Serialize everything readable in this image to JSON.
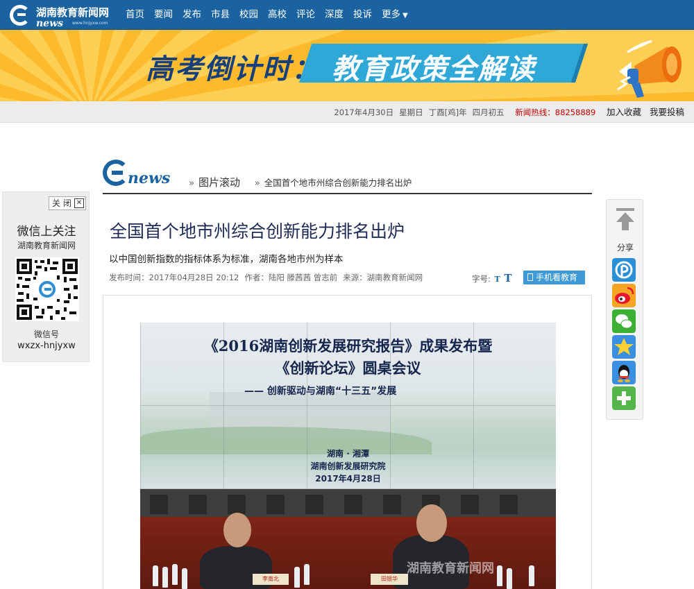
{
  "site": {
    "name": "湖南教育新闻网",
    "logo_word": "news",
    "url": "www.hnjyxw.com"
  },
  "nav": {
    "items": [
      "首页",
      "要闻",
      "发布",
      "市县",
      "校园",
      "高校",
      "评论",
      "深度",
      "投诉",
      "更多"
    ],
    "more_caret": "▼"
  },
  "banner": {
    "left_text": "高考倒计时：",
    "right_text": "教育政策全解读"
  },
  "infobar": {
    "date": "2017年4月30日",
    "weekday": "星期日",
    "lunar_year": "丁酉[鸡]年",
    "lunar_day": "四月初五",
    "hotline_label": "新闻热线：",
    "hotline": "88258889",
    "bookmark": "加入收藏",
    "submit": "我要投稿"
  },
  "breadcrumb": {
    "logo_word": "news",
    "sep": "»",
    "section": "图片滚动",
    "current": "全国首个地市州综合创新能力排名出炉"
  },
  "wechat": {
    "close": "关 闭",
    "close_x": "✕",
    "follow": "微信上关注",
    "site": "湖南教育新闻网",
    "id_label": "微信号",
    "id": "wxzx-hnjyxw"
  },
  "article": {
    "title": "全国首个地市州综合创新能力排名出炉",
    "subtitle": "以中国创新指数的指标体系为标准，湖南各地市州为样本",
    "meta": {
      "published": "发布时间：2017年04月28日  20:12",
      "author": "作者：陆阳 滕茜茜 曾志前",
      "source": "来源：湖南教育新闻网"
    },
    "font_label": "字号:",
    "font_small": "T",
    "font_large": "T",
    "mobile": "手机看教育"
  },
  "photo": {
    "line1": "《2016湖南创新发展研究报告》成果发布暨",
    "line2": "《创新论坛》圆桌会议",
    "line3": "—— 创新驱动与湖南“十三五”发展",
    "line4": "湖南 · 湘潭",
    "line5": "湖南创新发展研究院",
    "line6": "2017年4月28日",
    "card1": "李南北",
    "card2": "田银华",
    "watermark": "湖南教育新闻网"
  },
  "share": {
    "label": "分享",
    "icons": [
      "qzone-icon",
      "weibo-icon",
      "wechat-icon",
      "qzone-star-icon",
      "qq-icon",
      "more-icon"
    ]
  },
  "colors": {
    "nav_bg": "#1a63a0",
    "banner_bg": "#fdc33a",
    "accent_blue": "#3d9ad7",
    "title": "#1d2a55"
  }
}
